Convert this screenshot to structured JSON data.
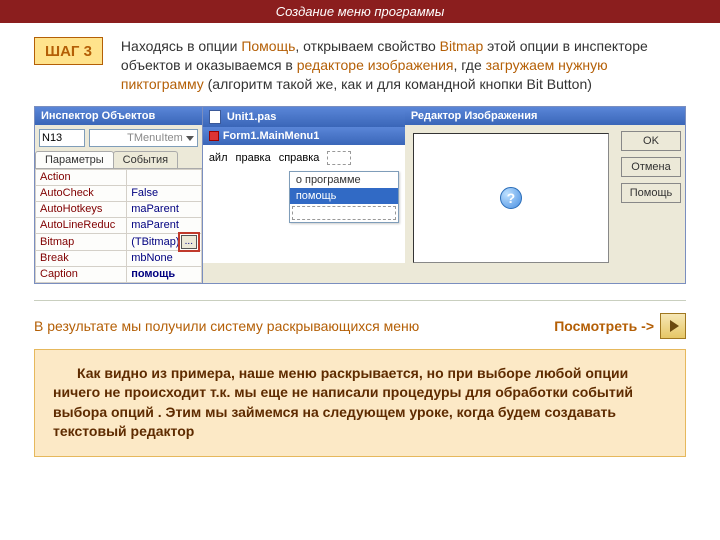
{
  "title": "Создание меню программы",
  "step_label": "ШАГ 3",
  "intro": {
    "p1a": "Находясь в опции ",
    "p1b": "Помощь",
    "p1c": ", открываем свойство ",
    "p1d": "Bitmap",
    "p1e": " этой опции в инспекторе объектов и оказываемся в ",
    "p1f": "редакторе изображения",
    "p1g": ", где ",
    "p1h": "загружаем нужную пиктограмму",
    "p1i": " (алгоритм такой же, как и для командной кнопки Bit Button)"
  },
  "inspector": {
    "title": "Инспектор Объектов",
    "object_name": "N13",
    "object_type": "TMenuItem",
    "tab_params": "Параметры",
    "tab_events": "События",
    "rows": [
      {
        "k": "Action",
        "v": ""
      },
      {
        "k": "AutoCheck",
        "v": "False"
      },
      {
        "k": "AutoHotkeys",
        "v": "maParent"
      },
      {
        "k": "AutoLineReduc",
        "v": "maParent"
      },
      {
        "k": "Bitmap",
        "v": "(TBitmap)"
      },
      {
        "k": "Break",
        "v": "mbNone"
      },
      {
        "k": "Caption",
        "v": "помощь"
      }
    ],
    "ellipsis": "..."
  },
  "ide": {
    "unit_tab": "Unit1.pas",
    "mainmenu_title": "Form1.MainMenu1",
    "menu_file": "айл",
    "menu_edit": "правка",
    "menu_help": "справка",
    "dd_about": "о программе",
    "dd_help": "помощь"
  },
  "imgedit": {
    "title": "Редактор Изображения",
    "btn_ok": "OK",
    "btn_cancel": "Отмена",
    "btn_help": "Помощь"
  },
  "result_text": "В результате мы получили систему раскрывающихся меню",
  "see_label": "Посмотреть ->",
  "note": "Как видно из примера, наше меню раскрывается, но при выборе любой опции ничего не происходит  т.к.  мы еще не написали процедуры для обработки событий выбора опций . Этим мы займемся на следующем уроке, когда будем создавать текстовый редактор"
}
